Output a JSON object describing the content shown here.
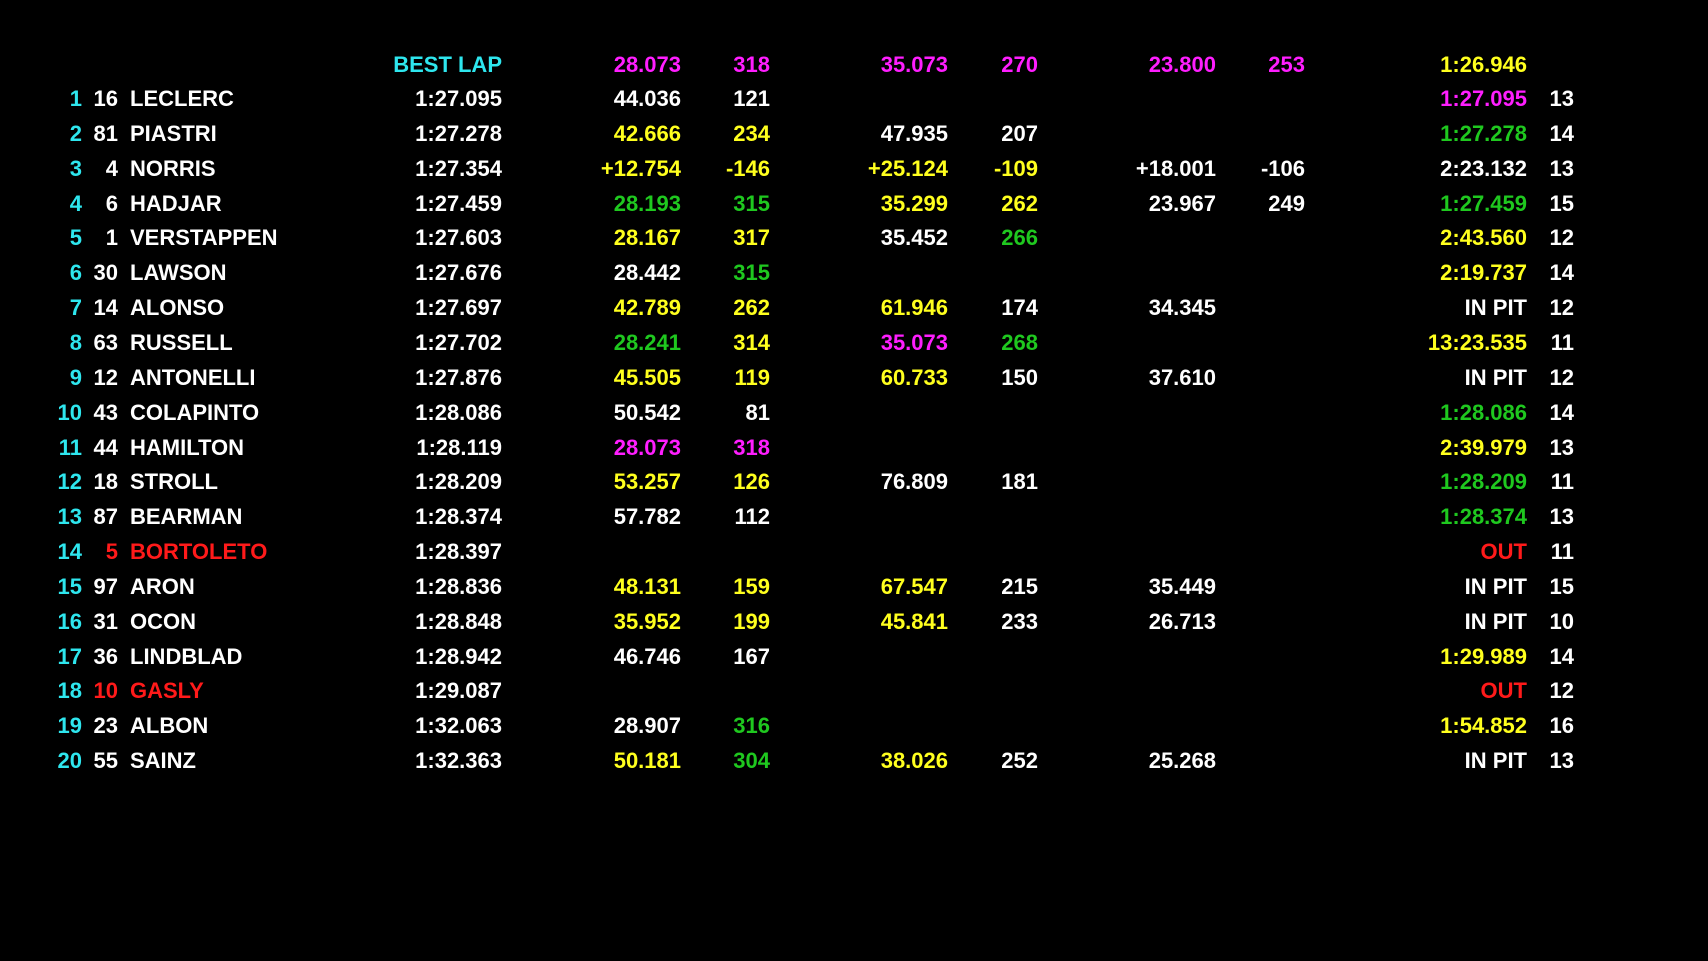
{
  "colors": {
    "background": "#000000",
    "cyan": "#2ee6ee",
    "white": "#ffffff",
    "yellow": "#ffff1e",
    "green": "#1fc81f",
    "magenta": "#ff1eff",
    "red": "#ff1a1a"
  },
  "best_row": {
    "label": "BEST LAP",
    "s1": "28.073",
    "s1_speed": "318",
    "s2": "35.073",
    "s2_speed": "270",
    "s3": "23.800",
    "s3_speed": "253",
    "best_lap": "1:26.946"
  },
  "drivers": [
    {
      "pos": "1",
      "num": "16",
      "name": "LECLERC",
      "best": "1:27.095",
      "s1": "44.036",
      "s1_color": "white",
      "s1sp": "121",
      "s1sp_color": "white",
      "s2": "",
      "s2_color": "white",
      "s2sp": "",
      "s2sp_color": "white",
      "s3": "",
      "s3sp": "",
      "last": "1:27.095",
      "last_color": "magenta",
      "laps": "13",
      "name_color": "white"
    },
    {
      "pos": "2",
      "num": "81",
      "name": "PIASTRI",
      "best": "1:27.278",
      "s1": "42.666",
      "s1_color": "yellow",
      "s1sp": "234",
      "s1sp_color": "yellow",
      "s2": "47.935",
      "s2_color": "white",
      "s2sp": "207",
      "s2sp_color": "white",
      "s3": "",
      "s3sp": "",
      "last": "1:27.278",
      "last_color": "green",
      "laps": "14",
      "name_color": "white"
    },
    {
      "pos": "3",
      "num": "4",
      "name": "NORRIS",
      "best": "1:27.354",
      "s1": "+12.754",
      "s1_color": "yellow",
      "s1sp": "-146",
      "s1sp_color": "yellow",
      "s2": "+25.124",
      "s2_color": "yellow",
      "s2sp": "-109",
      "s2sp_color": "yellow",
      "s3": "+18.001",
      "s3sp": "-106",
      "last": "2:23.132",
      "last_color": "white",
      "laps": "13",
      "name_color": "white"
    },
    {
      "pos": "4",
      "num": "6",
      "name": "HADJAR",
      "best": "1:27.459",
      "s1": "28.193",
      "s1_color": "green",
      "s1sp": "315",
      "s1sp_color": "green",
      "s2": "35.299",
      "s2_color": "yellow",
      "s2sp": "262",
      "s2sp_color": "yellow",
      "s3": "23.967",
      "s3sp": "249",
      "last": "1:27.459",
      "last_color": "green",
      "laps": "15",
      "name_color": "white"
    },
    {
      "pos": "5",
      "num": "1",
      "name": "VERSTAPPEN",
      "best": "1:27.603",
      "s1": "28.167",
      "s1_color": "yellow",
      "s1sp": "317",
      "s1sp_color": "yellow",
      "s2": "35.452",
      "s2_color": "white",
      "s2sp": "266",
      "s2sp_color": "green",
      "s3": "",
      "s3sp": "",
      "last": "2:43.560",
      "last_color": "yellow",
      "laps": "12",
      "name_color": "white"
    },
    {
      "pos": "6",
      "num": "30",
      "name": "LAWSON",
      "best": "1:27.676",
      "s1": "28.442",
      "s1_color": "white",
      "s1sp": "315",
      "s1sp_color": "green",
      "s2": "",
      "s2_color": "white",
      "s2sp": "",
      "s2sp_color": "white",
      "s3": "",
      "s3sp": "",
      "last": "2:19.737",
      "last_color": "yellow",
      "laps": "14",
      "name_color": "white"
    },
    {
      "pos": "7",
      "num": "14",
      "name": "ALONSO",
      "best": "1:27.697",
      "s1": "42.789",
      "s1_color": "yellow",
      "s1sp": "262",
      "s1sp_color": "yellow",
      "s2": "61.946",
      "s2_color": "yellow",
      "s2sp": "174",
      "s2sp_color": "white",
      "s3": "34.345",
      "s3sp": "",
      "last": "IN PIT",
      "last_color": "white",
      "laps": "12",
      "name_color": "white"
    },
    {
      "pos": "8",
      "num": "63",
      "name": "RUSSELL",
      "best": "1:27.702",
      "s1": "28.241",
      "s1_color": "green",
      "s1sp": "314",
      "s1sp_color": "yellow",
      "s2": "35.073",
      "s2_color": "magenta",
      "s2sp": "268",
      "s2sp_color": "green",
      "s3": "",
      "s3sp": "",
      "last": "13:23.535",
      "last_color": "yellow",
      "laps": "11",
      "name_color": "white"
    },
    {
      "pos": "9",
      "num": "12",
      "name": "ANTONELLI",
      "best": "1:27.876",
      "s1": "45.505",
      "s1_color": "yellow",
      "s1sp": "119",
      "s1sp_color": "yellow",
      "s2": "60.733",
      "s2_color": "yellow",
      "s2sp": "150",
      "s2sp_color": "white",
      "s3": "37.610",
      "s3sp": "",
      "last": "IN PIT",
      "last_color": "white",
      "laps": "12",
      "name_color": "white"
    },
    {
      "pos": "10",
      "num": "43",
      "name": "COLAPINTO",
      "best": "1:28.086",
      "s1": "50.542",
      "s1_color": "white",
      "s1sp": "81",
      "s1sp_color": "white",
      "s2": "",
      "s2_color": "white",
      "s2sp": "",
      "s2sp_color": "white",
      "s3": "",
      "s3sp": "",
      "last": "1:28.086",
      "last_color": "green",
      "laps": "14",
      "name_color": "white"
    },
    {
      "pos": "11",
      "num": "44",
      "name": "HAMILTON",
      "best": "1:28.119",
      "s1": "28.073",
      "s1_color": "magenta",
      "s1sp": "318",
      "s1sp_color": "magenta",
      "s2": "",
      "s2_color": "white",
      "s2sp": "",
      "s2sp_color": "white",
      "s3": "",
      "s3sp": "",
      "last": "2:39.979",
      "last_color": "yellow",
      "laps": "13",
      "name_color": "white"
    },
    {
      "pos": "12",
      "num": "18",
      "name": "STROLL",
      "best": "1:28.209",
      "s1": "53.257",
      "s1_color": "yellow",
      "s1sp": "126",
      "s1sp_color": "yellow",
      "s2": "76.809",
      "s2_color": "white",
      "s2sp": "181",
      "s2sp_color": "white",
      "s3": "",
      "s3sp": "",
      "last": "1:28.209",
      "last_color": "green",
      "laps": "11",
      "name_color": "white"
    },
    {
      "pos": "13",
      "num": "87",
      "name": "BEARMAN",
      "best": "1:28.374",
      "s1": "57.782",
      "s1_color": "white",
      "s1sp": "112",
      "s1sp_color": "white",
      "s2": "",
      "s2_color": "white",
      "s2sp": "",
      "s2sp_color": "white",
      "s3": "",
      "s3sp": "",
      "last": "1:28.374",
      "last_color": "green",
      "laps": "13",
      "name_color": "white"
    },
    {
      "pos": "14",
      "num": "5",
      "name": "BORTOLETO",
      "best": "1:28.397",
      "s1": "",
      "s1_color": "white",
      "s1sp": "",
      "s1sp_color": "white",
      "s2": "",
      "s2_color": "white",
      "s2sp": "",
      "s2sp_color": "white",
      "s3": "",
      "s3sp": "",
      "last": "OUT",
      "last_color": "red",
      "laps": "11",
      "name_color": "red"
    },
    {
      "pos": "15",
      "num": "97",
      "name": "ARON",
      "best": "1:28.836",
      "s1": "48.131",
      "s1_color": "yellow",
      "s1sp": "159",
      "s1sp_color": "yellow",
      "s2": "67.547",
      "s2_color": "yellow",
      "s2sp": "215",
      "s2sp_color": "white",
      "s3": "35.449",
      "s3sp": "",
      "last": "IN PIT",
      "last_color": "white",
      "laps": "15",
      "name_color": "white"
    },
    {
      "pos": "16",
      "num": "31",
      "name": "OCON",
      "best": "1:28.848",
      "s1": "35.952",
      "s1_color": "yellow",
      "s1sp": "199",
      "s1sp_color": "yellow",
      "s2": "45.841",
      "s2_color": "yellow",
      "s2sp": "233",
      "s2sp_color": "white",
      "s3": "26.713",
      "s3sp": "",
      "last": "IN PIT",
      "last_color": "white",
      "laps": "10",
      "name_color": "white"
    },
    {
      "pos": "17",
      "num": "36",
      "name": "LINDBLAD",
      "best": "1:28.942",
      "s1": "46.746",
      "s1_color": "white",
      "s1sp": "167",
      "s1sp_color": "white",
      "s2": "",
      "s2_color": "white",
      "s2sp": "",
      "s2sp_color": "white",
      "s3": "",
      "s3sp": "",
      "last": "1:29.989",
      "last_color": "yellow",
      "laps": "14",
      "name_color": "white"
    },
    {
      "pos": "18",
      "num": "10",
      "name": "GASLY",
      "best": "1:29.087",
      "s1": "",
      "s1_color": "white",
      "s1sp": "",
      "s1sp_color": "white",
      "s2": "",
      "s2_color": "white",
      "s2sp": "",
      "s2sp_color": "white",
      "s3": "",
      "s3sp": "",
      "last": "OUT",
      "last_color": "red",
      "laps": "12",
      "name_color": "red"
    },
    {
      "pos": "19",
      "num": "23",
      "name": "ALBON",
      "best": "1:32.063",
      "s1": "28.907",
      "s1_color": "white",
      "s1sp": "316",
      "s1sp_color": "green",
      "s2": "",
      "s2_color": "white",
      "s2sp": "",
      "s2sp_color": "white",
      "s3": "",
      "s3sp": "",
      "last": "1:54.852",
      "last_color": "yellow",
      "laps": "16",
      "name_color": "white"
    },
    {
      "pos": "20",
      "num": "55",
      "name": "SAINZ",
      "best": "1:32.363",
      "s1": "50.181",
      "s1_color": "yellow",
      "s1sp": "304",
      "s1sp_color": "green",
      "s2": "38.026",
      "s2_color": "yellow",
      "s2sp": "252",
      "s2sp_color": "white",
      "s3": "25.268",
      "s3sp": "",
      "last": "IN PIT",
      "last_color": "white",
      "laps": "13",
      "name_color": "white"
    }
  ]
}
